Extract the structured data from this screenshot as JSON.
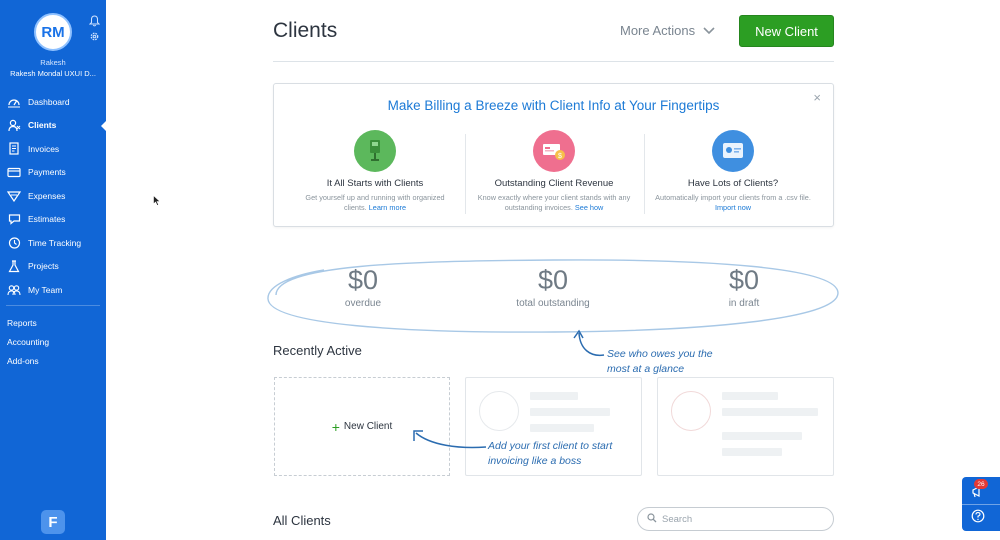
{
  "sidebar": {
    "avatar_initials": "RM",
    "user_first_name": "Rakesh",
    "user_company": "Rakesh Mondal UXUI D...",
    "nav": [
      {
        "label": "Dashboard",
        "icon": "dashboard-icon"
      },
      {
        "label": "Clients",
        "icon": "clients-icon",
        "active": true
      },
      {
        "label": "Invoices",
        "icon": "invoices-icon"
      },
      {
        "label": "Payments",
        "icon": "payments-icon"
      },
      {
        "label": "Expenses",
        "icon": "expenses-icon"
      },
      {
        "label": "Estimates",
        "icon": "estimates-icon"
      },
      {
        "label": "Time Tracking",
        "icon": "time-tracking-icon"
      },
      {
        "label": "Projects",
        "icon": "projects-icon"
      },
      {
        "label": "My Team",
        "icon": "team-icon"
      }
    ],
    "secondary": [
      "Reports",
      "Accounting",
      "Add-ons"
    ],
    "logo_letter": "F",
    "color": "#1166d6"
  },
  "header": {
    "title": "Clients",
    "more_actions": "More Actions",
    "new_client": "New Client",
    "new_client_color": "#2c9e23"
  },
  "promo": {
    "title": "Make Billing a Breeze with Client Info at Your Fingertips",
    "close": "×",
    "columns": [
      {
        "title": "It All Starts with Clients",
        "desc": "Get yourself up and running with organized clients.",
        "link": "Learn more",
        "icon": "client-card-icon",
        "color": "#5cb85c"
      },
      {
        "title": "Outstanding Client Revenue",
        "desc": "Know exactly where your client stands with any outstanding invoices.",
        "link": "See how",
        "icon": "revenue-card-icon",
        "color": "#ef6f8f"
      },
      {
        "title": "Have Lots of Clients?",
        "desc": "Automatically import your clients from a .csv file.",
        "link": "Import now",
        "icon": "import-card-icon",
        "color": "#3f8fe0"
      }
    ]
  },
  "stats": [
    {
      "amount": "$0",
      "label": "overdue"
    },
    {
      "amount": "$0",
      "label": "total outstanding"
    },
    {
      "amount": "$0",
      "label": "in draft"
    }
  ],
  "hints": {
    "owes_line1": "See who owes you the",
    "owes_line2": "most at a glance",
    "first_line1": "Add your first client to start",
    "first_line2": "invoicing like a boss"
  },
  "recently_active": {
    "title": "Recently Active",
    "new_client_card": "New Client"
  },
  "all_clients": {
    "title": "All Clients",
    "search_placeholder": "Search"
  },
  "help_widget": {
    "badge": "26"
  }
}
